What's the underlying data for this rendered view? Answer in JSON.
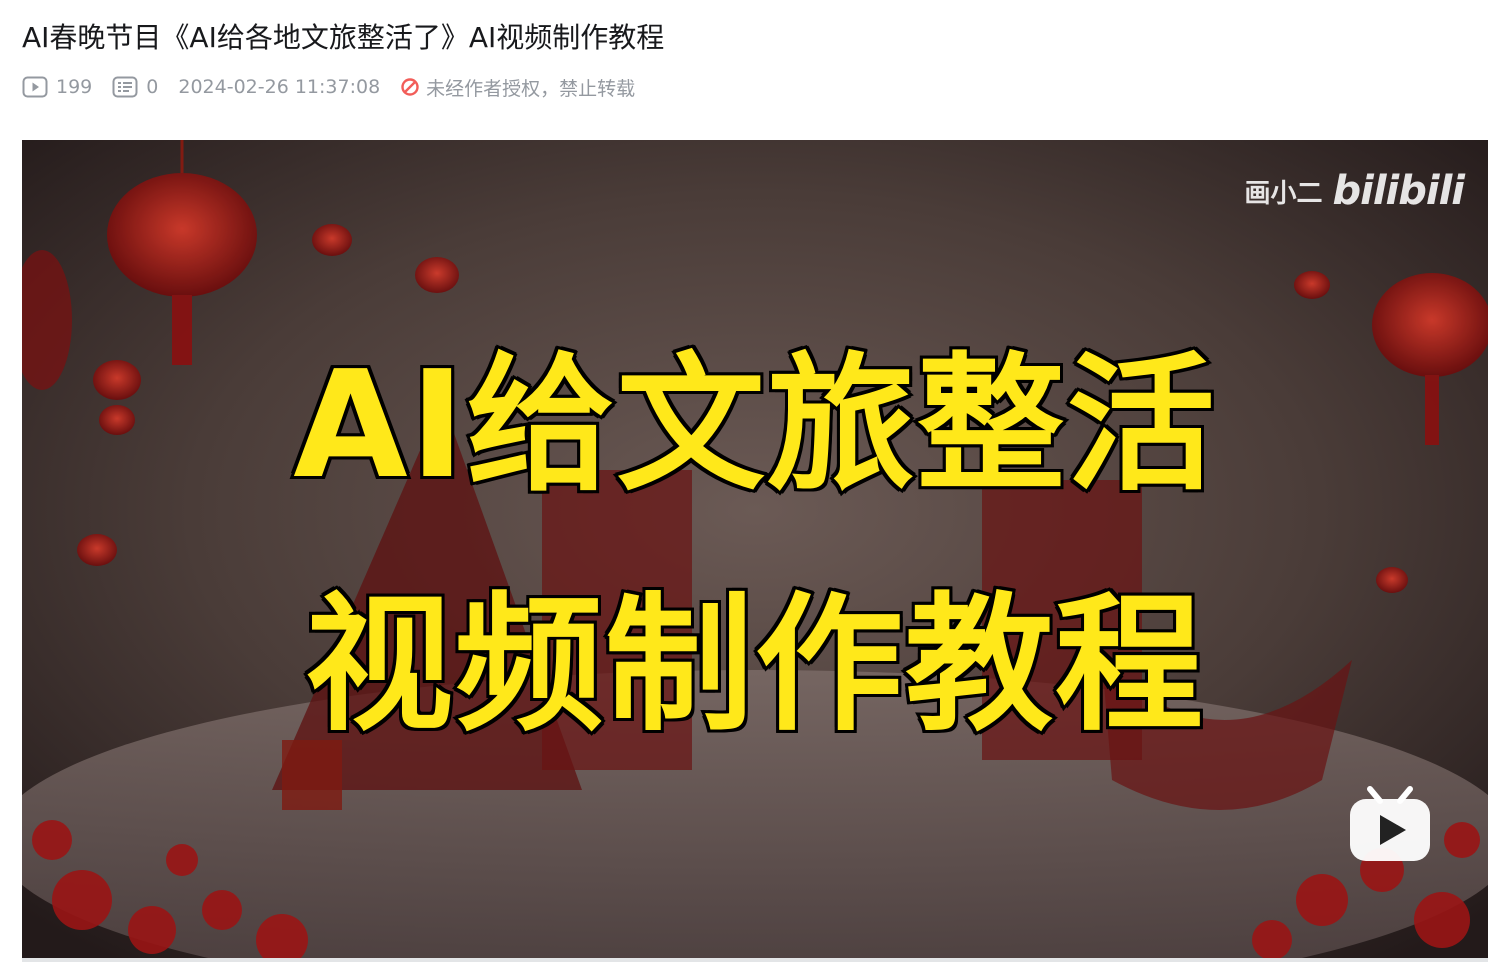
{
  "title": "AI春晚节目《AI给各地文旅整活了》AI视频制作教程",
  "stats": {
    "play_icon": "play-count-icon",
    "play_count": "199",
    "danmaku_icon": "danmaku-icon",
    "danmaku_count": "0",
    "publish_time": "2024-02-26 11:37:08",
    "copyright_icon": "forbidden-icon",
    "copyright_text": "未经作者授权，禁止转载"
  },
  "video": {
    "overlay_line1": "AI给文旅整活",
    "overlay_line2": "视频制作教程",
    "watermark_user": "画小二",
    "watermark_logo": "bilibili",
    "play_icon": "bilibili-tv-play-icon"
  },
  "colors": {
    "title_text": "#18191c",
    "meta_text": "#9499a0",
    "forbidden": "#f25d59",
    "overlay_yellow": "#ffe81a",
    "scene_red": "#b0141c"
  }
}
